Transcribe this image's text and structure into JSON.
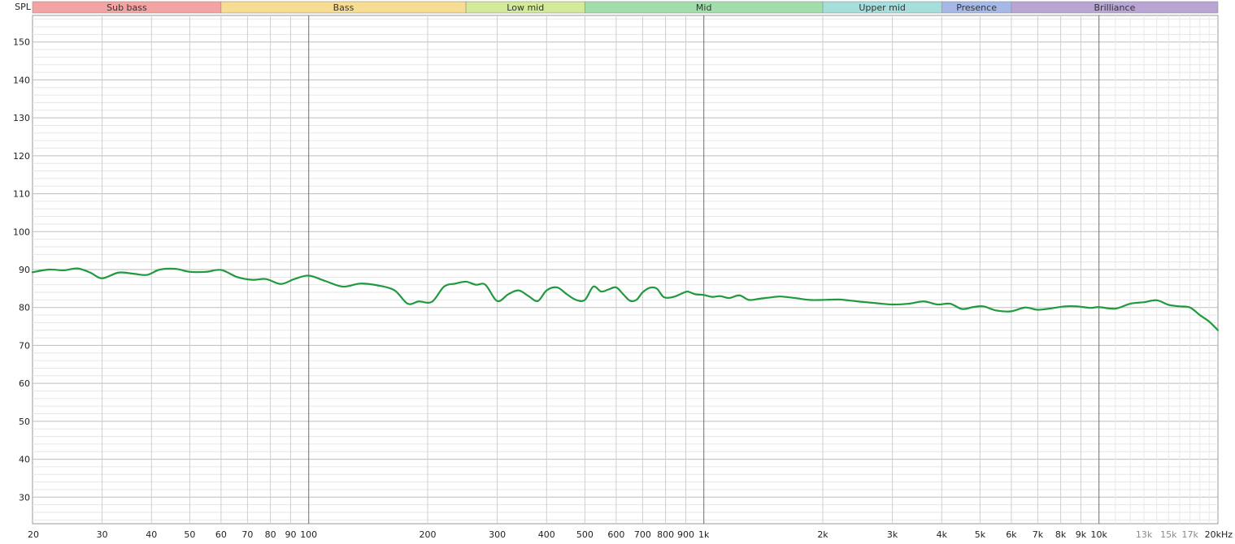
{
  "chart_data": {
    "type": "line",
    "title": "",
    "ylabel": "SPL",
    "xlabel": "",
    "x_scale": "log",
    "xlim": [
      20,
      20000
    ],
    "ylim": [
      23,
      157
    ],
    "grid": true,
    "bands": [
      {
        "label": "Sub bass",
        "from": 20,
        "to": 60,
        "color": "#f4a3a3"
      },
      {
        "label": "Bass",
        "from": 60,
        "to": 250,
        "color": "#f7dc94"
      },
      {
        "label": "Low mid",
        "from": 250,
        "to": 500,
        "color": "#d3ea9a"
      },
      {
        "label": "Mid",
        "from": 500,
        "to": 2000,
        "color": "#a2deac"
      },
      {
        "label": "Upper mid",
        "from": 2000,
        "to": 4000,
        "color": "#a5dedb"
      },
      {
        "label": "Presence",
        "from": 4000,
        "to": 6000,
        "color": "#a5b8e6"
      },
      {
        "label": "Brilliance",
        "from": 6000,
        "to": 20000,
        "color": "#b9a5d3"
      }
    ],
    "y_ticks": [
      {
        "value": 150,
        "label": "150"
      },
      {
        "value": 140,
        "label": "140"
      },
      {
        "value": 130,
        "label": "130"
      },
      {
        "value": 120,
        "label": "120"
      },
      {
        "value": 110,
        "label": "110"
      },
      {
        "value": 100,
        "label": "100"
      },
      {
        "value": 90,
        "label": "90"
      },
      {
        "value": 80,
        "label": "80"
      },
      {
        "value": 70,
        "label": "70"
      },
      {
        "value": 60,
        "label": "60"
      },
      {
        "value": 50,
        "label": "50"
      },
      {
        "value": 40,
        "label": "40"
      },
      {
        "value": 30,
        "label": "30"
      }
    ],
    "x_ticks": [
      {
        "value": 20,
        "label": "20"
      },
      {
        "value": 30,
        "label": "30"
      },
      {
        "value": 40,
        "label": "40"
      },
      {
        "value": 50,
        "label": "50"
      },
      {
        "value": 60,
        "label": "60"
      },
      {
        "value": 70,
        "label": "70"
      },
      {
        "value": 80,
        "label": "80"
      },
      {
        "value": 90,
        "label": "90"
      },
      {
        "value": 100,
        "label": "100"
      },
      {
        "value": 200,
        "label": "200"
      },
      {
        "value": 300,
        "label": "300"
      },
      {
        "value": 400,
        "label": "400"
      },
      {
        "value": 500,
        "label": "500"
      },
      {
        "value": 600,
        "label": "600"
      },
      {
        "value": 700,
        "label": "700"
      },
      {
        "value": 800,
        "label": "800"
      },
      {
        "value": 900,
        "label": "900"
      },
      {
        "value": 1000,
        "label": "1k"
      },
      {
        "value": 2000,
        "label": "2k"
      },
      {
        "value": 3000,
        "label": "3k"
      },
      {
        "value": 4000,
        "label": "4k"
      },
      {
        "value": 5000,
        "label": "5k"
      },
      {
        "value": 6000,
        "label": "6k"
      },
      {
        "value": 7000,
        "label": "7k"
      },
      {
        "value": 8000,
        "label": "8k"
      },
      {
        "value": 9000,
        "label": "9k"
      },
      {
        "value": 10000,
        "label": "10k"
      },
      {
        "value": 13000,
        "label": "13k",
        "faint": true
      },
      {
        "value": 15000,
        "label": "15k",
        "faint": true
      },
      {
        "value": 17000,
        "label": "17k",
        "faint": true
      },
      {
        "value": 20000,
        "label": "20kHz"
      }
    ],
    "series": [
      {
        "color": "#1f9a3c",
        "x": [
          20,
          22,
          24,
          26,
          28,
          30,
          33,
          36,
          39,
          42,
          46,
          50,
          55,
          60,
          66,
          72,
          78,
          85,
          92,
          100,
          110,
          122,
          135,
          150,
          165,
          178,
          190,
          205,
          220,
          235,
          250,
          265,
          280,
          300,
          320,
          340,
          360,
          380,
          400,
          425,
          450,
          475,
          500,
          525,
          550,
          575,
          600,
          625,
          650,
          675,
          700,
          730,
          760,
          790,
          820,
          850,
          880,
          910,
          950,
          1000,
          1050,
          1100,
          1160,
          1230,
          1300,
          1380,
          1460,
          1560,
          1700,
          1850,
          2000,
          2200,
          2450,
          2700,
          3000,
          3300,
          3600,
          3900,
          4200,
          4500,
          4800,
          5100,
          5500,
          6000,
          6500,
          7000,
          7600,
          8200,
          8800,
          9500,
          10000,
          11000,
          12000,
          13000,
          14000,
          15000,
          16000,
          17000,
          18000,
          19000,
          20000
        ],
        "y": [
          89.3,
          90.0,
          89.8,
          90.3,
          89.2,
          87.7,
          89.2,
          88.9,
          88.6,
          90.0,
          90.2,
          89.4,
          89.4,
          89.9,
          88.0,
          87.3,
          87.5,
          86.2,
          87.5,
          88.4,
          87.0,
          85.5,
          86.3,
          85.8,
          84.5,
          81.0,
          81.6,
          81.5,
          85.5,
          86.3,
          86.8,
          86.0,
          86.0,
          81.7,
          83.5,
          84.5,
          83.0,
          81.7,
          84.5,
          85.3,
          83.5,
          82.0,
          82.0,
          85.5,
          84.2,
          84.8,
          85.3,
          83.5,
          81.8,
          82.0,
          84.0,
          85.2,
          85.0,
          82.8,
          82.6,
          83.0,
          83.7,
          84.2,
          83.5,
          83.3,
          82.8,
          83.0,
          82.5,
          83.2,
          82.0,
          82.3,
          82.6,
          82.9,
          82.5,
          82.0,
          82.0,
          82.1,
          81.6,
          81.2,
          80.8,
          81.0,
          81.6,
          80.8,
          81.0,
          79.6,
          80.1,
          80.3,
          79.2,
          79.0,
          80.0,
          79.4,
          79.8,
          80.3,
          80.3,
          79.9,
          80.1,
          79.7,
          81.0,
          81.4,
          81.9,
          80.7,
          80.3,
          80.0,
          78.0,
          76.3,
          74.0
        ]
      }
    ]
  }
}
